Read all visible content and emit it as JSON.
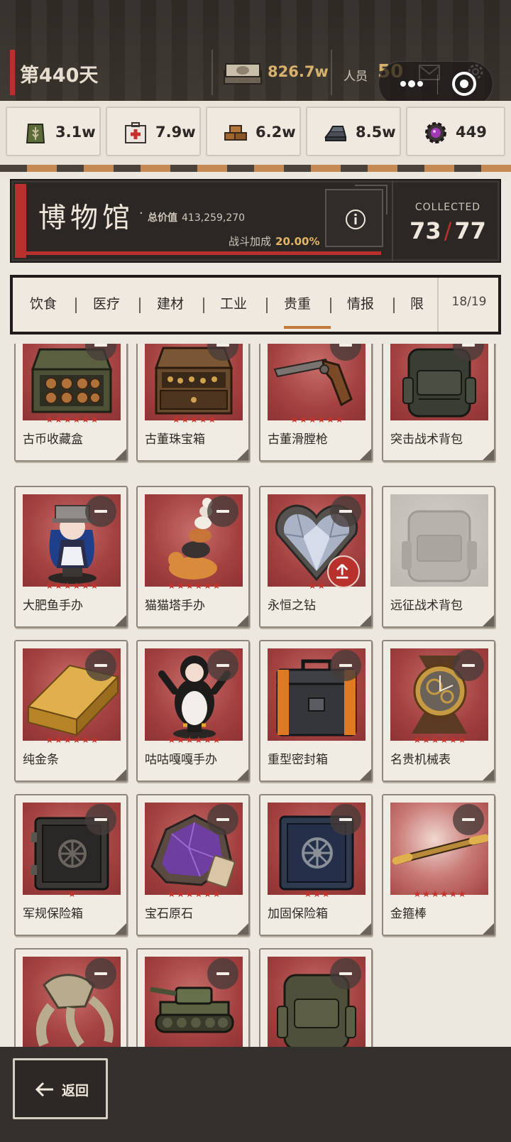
{
  "topbar": {
    "day": "第440天",
    "money": "826.7w",
    "people_label": "人员",
    "people_value": "50"
  },
  "resources": [
    {
      "icon": "grain-sack-icon",
      "value": "3.1w"
    },
    {
      "icon": "medkit-icon",
      "value": "7.9w"
    },
    {
      "icon": "bricks-icon",
      "value": "6.2w"
    },
    {
      "icon": "steel-ingot-icon",
      "value": "8.5w"
    },
    {
      "icon": "gem-gear-icon",
      "value": "449"
    }
  ],
  "museum": {
    "title": "博物馆",
    "dot": "·",
    "total_label": "总价值",
    "total_value": "413,259,270",
    "bonus_label": "战斗加成",
    "bonus_value": "20.00%",
    "collected_label": "COLLECTED",
    "collected_have": "73",
    "collected_sep": "/",
    "collected_total": "77"
  },
  "tabs": {
    "items": [
      "饮食",
      "医疗",
      "建材",
      "工业",
      "贵重",
      "情报",
      "限"
    ],
    "active_index": 4,
    "count": "18/19"
  },
  "items": [
    {
      "name": "古币收藏盒",
      "stars": "★★★★★★",
      "art": "coin-box"
    },
    {
      "name": "古董珠宝箱",
      "stars": "★★★★★",
      "art": "jewel-chest"
    },
    {
      "name": "古董滑膛枪",
      "stars": "★★★★★★",
      "art": "musket"
    },
    {
      "name": "突击战术背包",
      "stars": "",
      "art": "backpack"
    },
    {
      "name": "大肥鱼手办",
      "stars": "★★★★★★",
      "art": "figure-girl"
    },
    {
      "name": "猫猫塔手办",
      "stars": "★★★★★★",
      "art": "cat-tower"
    },
    {
      "name": "永恒之钻",
      "stars": "★★",
      "art": "diamond"
    },
    {
      "name": "远征战术背包",
      "stars": "",
      "art": "backpack-gray"
    },
    {
      "name": "纯金条",
      "stars": "★★★★★★",
      "art": "gold-bar"
    },
    {
      "name": "咕咕嘎嘎手办",
      "stars": "★★★★★★",
      "art": "penguin"
    },
    {
      "name": "重型密封箱",
      "stars": "",
      "art": "sealed-case"
    },
    {
      "name": "名贵机械表",
      "stars": "★★★★★★",
      "art": "watch"
    },
    {
      "name": "军规保险箱",
      "stars": "★",
      "art": "safe"
    },
    {
      "name": "宝石原石",
      "stars": "★★★★★★",
      "art": "raw-gem"
    },
    {
      "name": "加固保险箱",
      "stars": "★★★",
      "art": "safe-blue"
    },
    {
      "name": "金箍棒",
      "stars": "★★★★★★",
      "art": "staff"
    },
    {
      "name": "",
      "stars": "",
      "art": "claw"
    },
    {
      "name": "",
      "stars": "",
      "art": "tank"
    },
    {
      "name": "",
      "stars": "",
      "art": "backpack-olive"
    }
  ],
  "bottom": {
    "back_label": "返回"
  },
  "colors": {
    "accent_red": "#b8312c",
    "gold": "#d8b26c",
    "star_red": "#c4332b",
    "tab_underline": "#c17a3c"
  }
}
